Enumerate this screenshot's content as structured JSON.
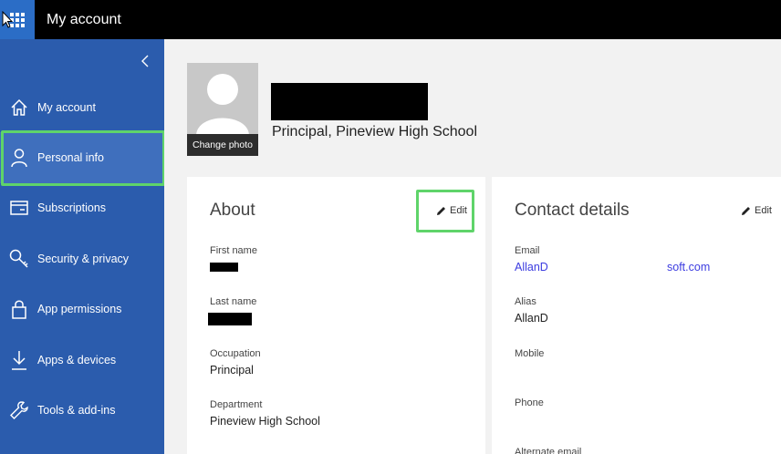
{
  "topbar": {
    "title": "My account"
  },
  "sidebar": {
    "items": [
      {
        "label": "My account",
        "icon": "home-icon"
      },
      {
        "label": "Personal info",
        "icon": "person-icon"
      },
      {
        "label": "Subscriptions",
        "icon": "card-icon"
      },
      {
        "label": "Security & privacy",
        "icon": "key-icon"
      },
      {
        "label": "App permissions",
        "icon": "lock-icon"
      },
      {
        "label": "Apps & devices",
        "icon": "download-icon"
      },
      {
        "label": "Tools & add-ins",
        "icon": "wrench-icon"
      }
    ]
  },
  "profile": {
    "change_photo_label": "Change photo",
    "job_title": "Principal, Pineview High School"
  },
  "about": {
    "title": "About",
    "edit_label": "Edit",
    "first_name_label": "First name",
    "last_name_label": "Last name",
    "occupation_label": "Occupation",
    "occupation_value": "Principal",
    "department_label": "Department",
    "department_value": "Pineview High School"
  },
  "contact": {
    "title": "Contact details",
    "edit_label": "Edit",
    "email_label": "Email",
    "email_value_start": "AllanD",
    "email_value_end": "soft.com",
    "alias_label": "Alias",
    "alias_value": "AllanD",
    "mobile_label": "Mobile",
    "phone_label": "Phone",
    "alternate_email_label": "Alternate email"
  },
  "colors": {
    "sidebar": "#2b5cad",
    "highlight": "#5fd46a",
    "link": "#3c3ce0"
  }
}
